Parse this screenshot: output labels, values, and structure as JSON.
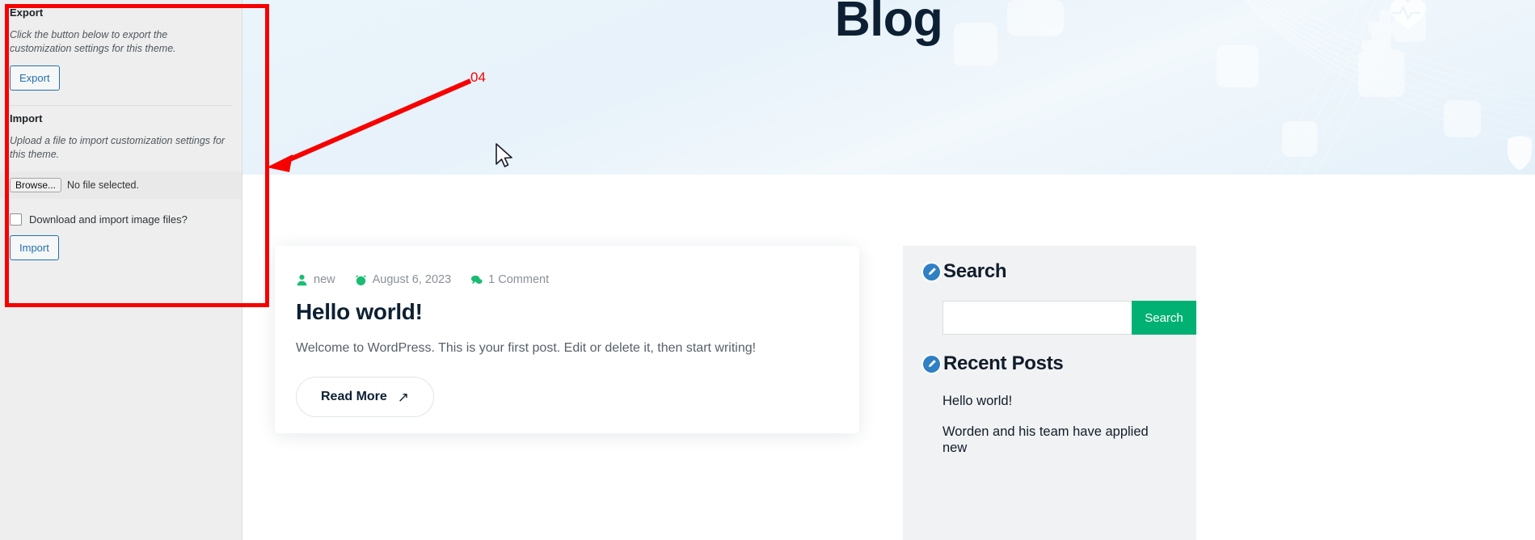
{
  "customizer": {
    "export": {
      "heading": "Export",
      "description": "Click the button below to export the customization settings for this theme.",
      "button_label": "Export"
    },
    "import": {
      "heading": "Import",
      "description": "Upload a file to import customization settings for this theme.",
      "browse_label": "Browse...",
      "file_status": "No file selected.",
      "checkbox_label": "Download and import image files?",
      "button_label": "Import"
    }
  },
  "site": {
    "banner": {
      "title": "Blog"
    },
    "post": {
      "author": "new",
      "date": "August 6, 2023",
      "comments": "1 Comment",
      "title": "Hello world!",
      "excerpt": "Welcome to WordPress. This is your first post. Edit or delete it, then start writing!",
      "read_more_label": "Read More",
      "read_more_arrow": "↗"
    },
    "sidebar": {
      "search_widget": {
        "title": "Search",
        "input_value": "",
        "input_placeholder": "",
        "submit_label": "Search"
      },
      "recent_posts_widget": {
        "title": "Recent Posts",
        "items": [
          "Hello world!",
          "Worden and his team have applied new"
        ]
      }
    }
  },
  "annotations": {
    "step_label": "04",
    "highlight_color": "#f60000"
  },
  "colors": {
    "accent_green": "#00b173",
    "meta_green": "#18bd72",
    "widget_icon_blue": "#2f80c4",
    "heading_dark": "#0d2033",
    "panel_gray": "#eeeeee",
    "widget_bg": "#f1f2f3",
    "banner_blue": "#e7f2fa"
  }
}
